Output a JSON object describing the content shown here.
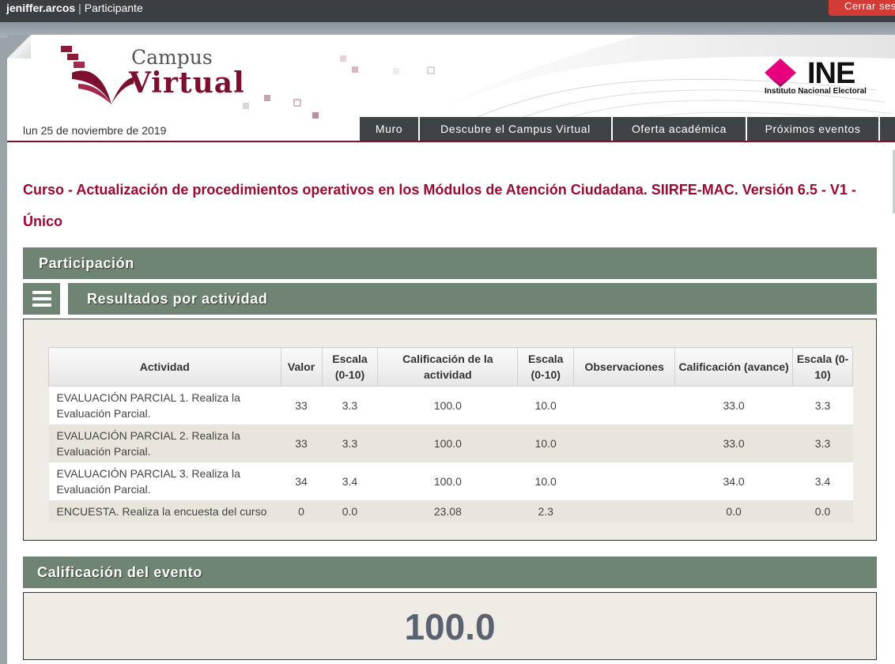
{
  "topbar": {
    "username": "jeniffer.arcos",
    "separator": "|",
    "role": "Participante",
    "logout_label": "Cerrar sesión"
  },
  "header": {
    "campus_word": "Campus",
    "virtual_word": "Virtual",
    "ine_text": "INE",
    "ine_sub": "Instituto Nacional Electoral",
    "date": "lun 25 de noviembre de 2019",
    "nav": [
      "Muro",
      "Descubre el Campus Virtual",
      "Oferta académica",
      "Próximos eventos"
    ]
  },
  "course_title": "Curso - Actualización de procedimientos operativos en los Módulos de Atención Ciudadana. SIIRFE-MAC. Versión 6.5 - V1 - Único",
  "sections": {
    "participation": "Participación",
    "results": "Resultados por actividad",
    "event_grade": "Calificación del evento"
  },
  "table": {
    "headers": [
      "Actividad",
      "Valor",
      "Escala (0-10)",
      "Calificación de la actividad",
      "Escala (0-10)",
      "Observaciones",
      "Calificación (avance)",
      "Escala (0-10)"
    ],
    "rows": [
      [
        "EVALUACIÓN PARCIAL 1. Realiza la Evaluación Parcial.",
        "33",
        "3.3",
        "100.0",
        "10.0",
        "",
        "33.0",
        "3.3"
      ],
      [
        "EVALUACIÓN PARCIAL 2. Realiza la Evaluación Parcial.",
        "33",
        "3.3",
        "100.0",
        "10.0",
        "",
        "33.0",
        "3.3"
      ],
      [
        "EVALUACIÓN PARCIAL 3. Realiza la Evaluación Parcial.",
        "34",
        "3.4",
        "100.0",
        "10.0",
        "",
        "34.0",
        "3.4"
      ],
      [
        "ENCUESTA. Realiza la encuesta del curso",
        "0",
        "0.0",
        "23.08",
        "2.3",
        "",
        "0.0",
        "0.0"
      ]
    ]
  },
  "event_grade_value": "100.0",
  "colors": {
    "brand": "#7c1233",
    "section": "#6f8473",
    "title": "#9b0a32",
    "ine_magenta": "#e6007e"
  }
}
